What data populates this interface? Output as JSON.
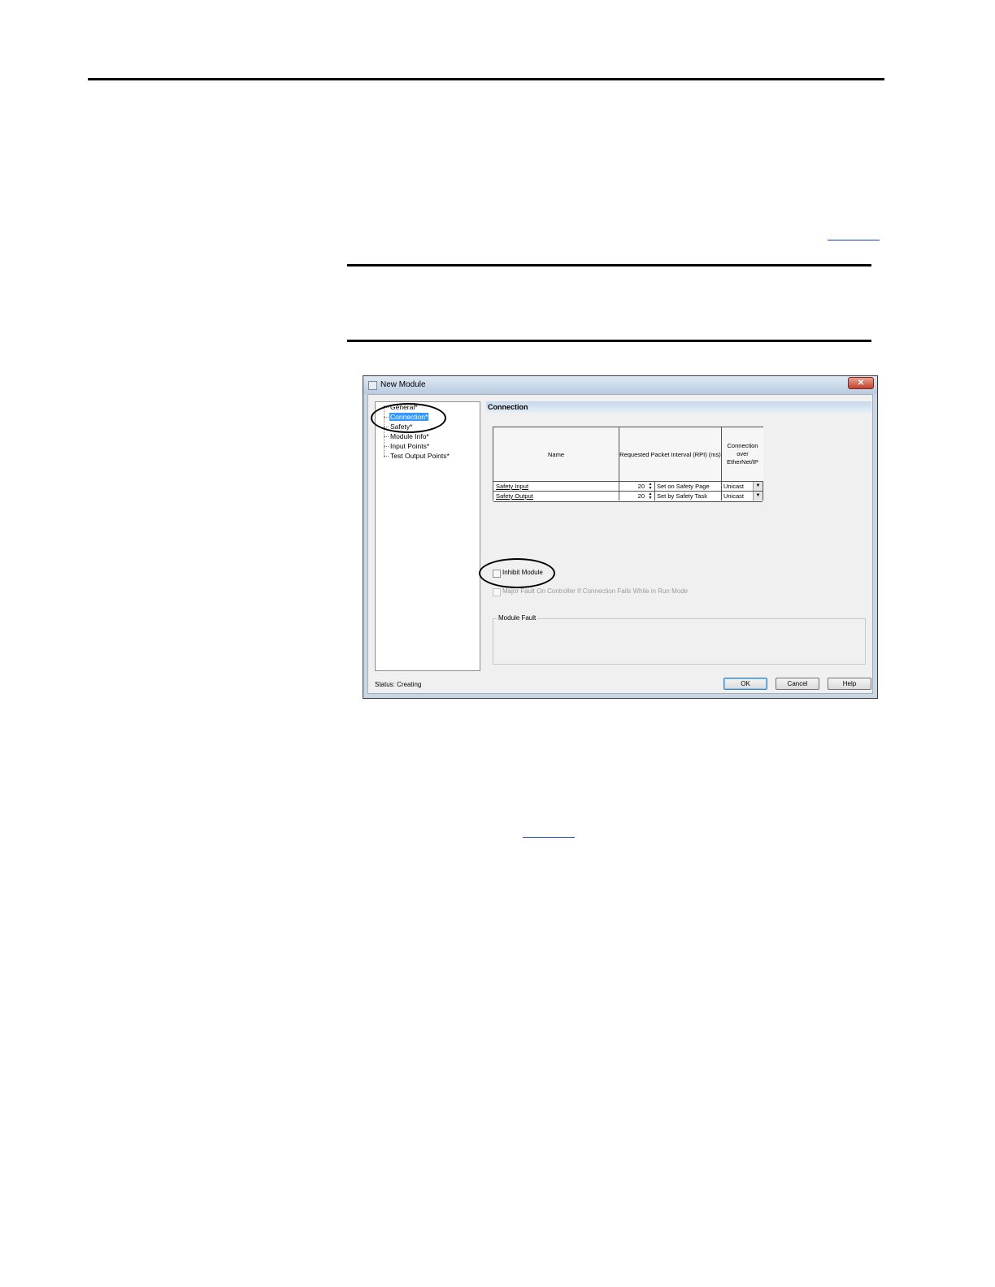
{
  "dialog": {
    "title": "New Module",
    "close_glyph": "✕",
    "tree": [
      "General*",
      "Connection*",
      "Safety*",
      "Module Info*",
      "Input Points*",
      "Test Output Points*"
    ],
    "selected_index": 1,
    "section_title": "Connection",
    "table": {
      "headers": [
        "Name",
        "Requested Packet Interval (RPI) (ms)",
        "Connection over EtherNet/IP"
      ],
      "rows": [
        {
          "name": "Safety Input",
          "rpi": "20",
          "source": "Set on Safety Page",
          "connection": "Unicast"
        },
        {
          "name": "Safety Output",
          "rpi": "20",
          "source": "Set by Safety Task",
          "connection": "Unicast"
        }
      ]
    },
    "inhibit_label": "Inhibit Module",
    "major_fault_label": "Major Fault On Controller If Connection Fails While in Run Mode",
    "module_fault_label": "Module Fault",
    "status": "Status:  Creating",
    "buttons": {
      "ok": "OK",
      "cancel": "Cancel",
      "help": "Help"
    }
  }
}
